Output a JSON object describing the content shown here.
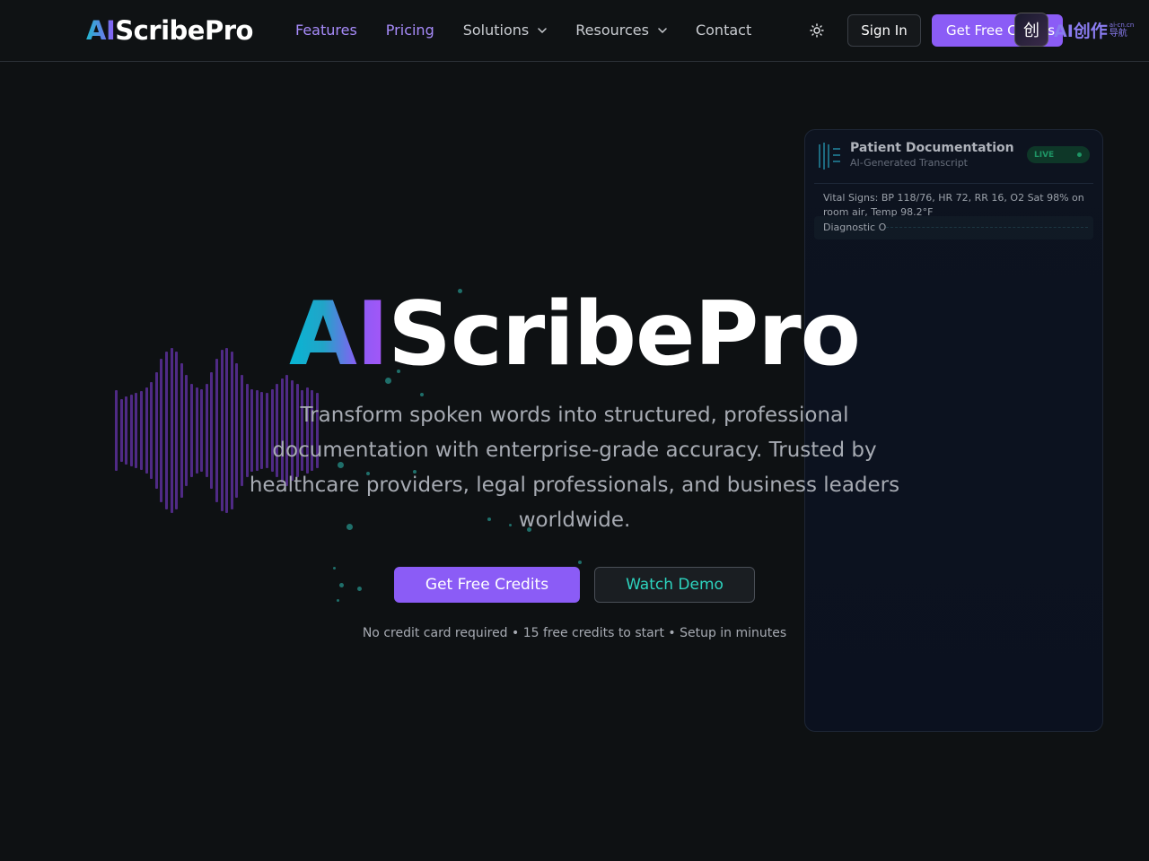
{
  "nav": {
    "logo_ai": "AI",
    "logo_rest": "ScribePro",
    "links": [
      {
        "label": "Features"
      },
      {
        "label": "Pricing"
      },
      {
        "label": "Solutions"
      },
      {
        "label": "Resources"
      },
      {
        "label": "Contact"
      }
    ],
    "sign_in": "Sign In",
    "get_free": "Get Free Credits",
    "theme_icon": "sun-icon"
  },
  "watermark": {
    "glyph": "创",
    "text": "AI创作",
    "small_top": "ai-cn.cn",
    "small_bottom": "导航"
  },
  "hero": {
    "title_ai": "AI",
    "title_rest": "ScribePro",
    "subtitle": "Transform spoken words into structured, professional documentation with enterprise-grade accuracy. Trusted by healthcare providers, legal professionals, and business leaders worldwide.",
    "cta_primary": "Get Free Credits",
    "cta_secondary": "Watch Demo",
    "note": "No credit card required • 15 free credits to start • Setup in minutes"
  },
  "panel": {
    "title": "Patient Documentation",
    "subtitle": "AI-Generated Transcript",
    "badge": "LIVE",
    "line1": "Vital Signs: BP 118/76, HR 72, RR 16, O2 Sat 98% on room air, Temp 98.2°F",
    "line2": "Diagnostic O"
  },
  "colors": {
    "accent_purple": "#8b5cf6",
    "accent_teal": "#2dd4bf",
    "background": "#0e1113",
    "live_green": "#1f9d6a"
  }
}
